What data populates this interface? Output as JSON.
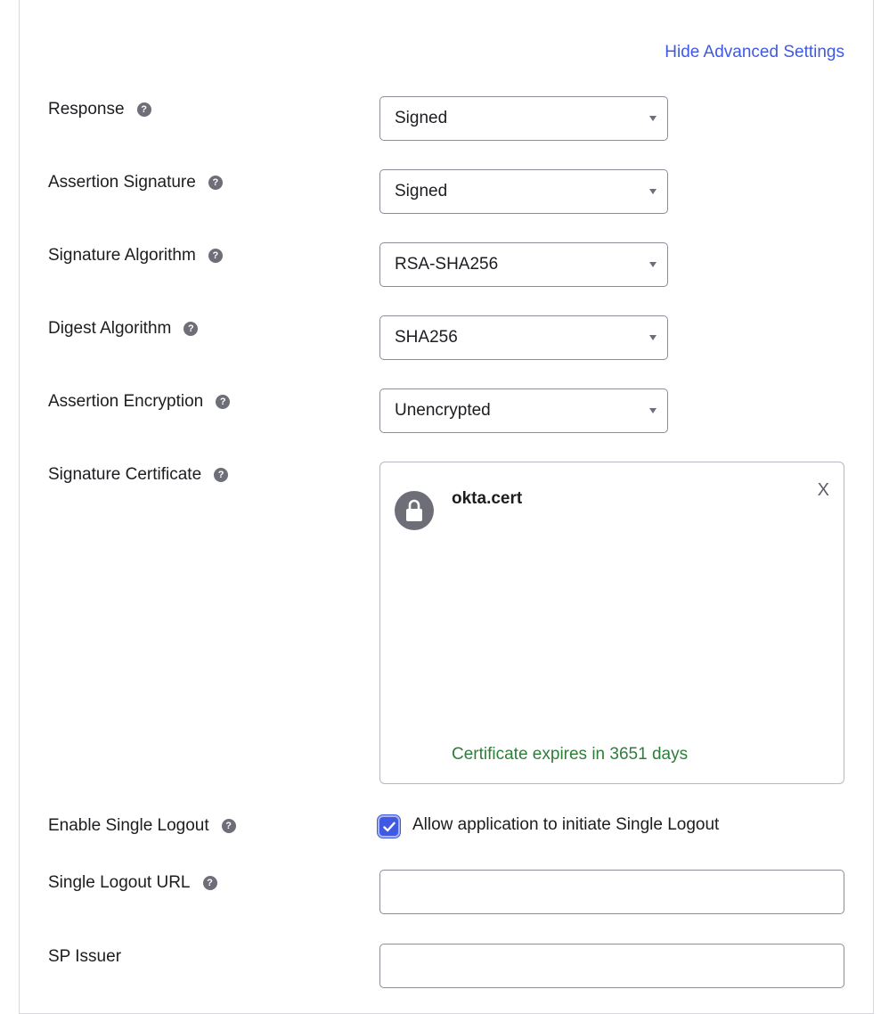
{
  "header": {
    "hide_advanced_label": "Hide Advanced Settings"
  },
  "fields": [
    {
      "label": "Response",
      "value": "Signed"
    },
    {
      "label": "Assertion Signature",
      "value": "Signed"
    },
    {
      "label": "Signature Algorithm",
      "value": "RSA-SHA256"
    },
    {
      "label": "Digest Algorithm",
      "value": "SHA256"
    },
    {
      "label": "Assertion Encryption",
      "value": "Unencrypted"
    }
  ],
  "signature_certificate": {
    "label": "Signature Certificate",
    "file_name": "okta.cert",
    "remove_label": "X",
    "expiry_text": "Certificate expires in 3651 days",
    "icon": "lock-icon"
  },
  "single_logout": {
    "label": "Enable Single Logout",
    "checked": true,
    "checkbox_label": "Allow application to initiate Single Logout"
  },
  "single_logout_url": {
    "label": "Single Logout URL",
    "value": ""
  },
  "sp_issuer": {
    "label": "SP Issuer",
    "value": ""
  },
  "help_glyph": "?",
  "colors": {
    "accent": "#3f59e4",
    "success_text": "#2f7d3a",
    "help_icon": "#6e6e78"
  }
}
